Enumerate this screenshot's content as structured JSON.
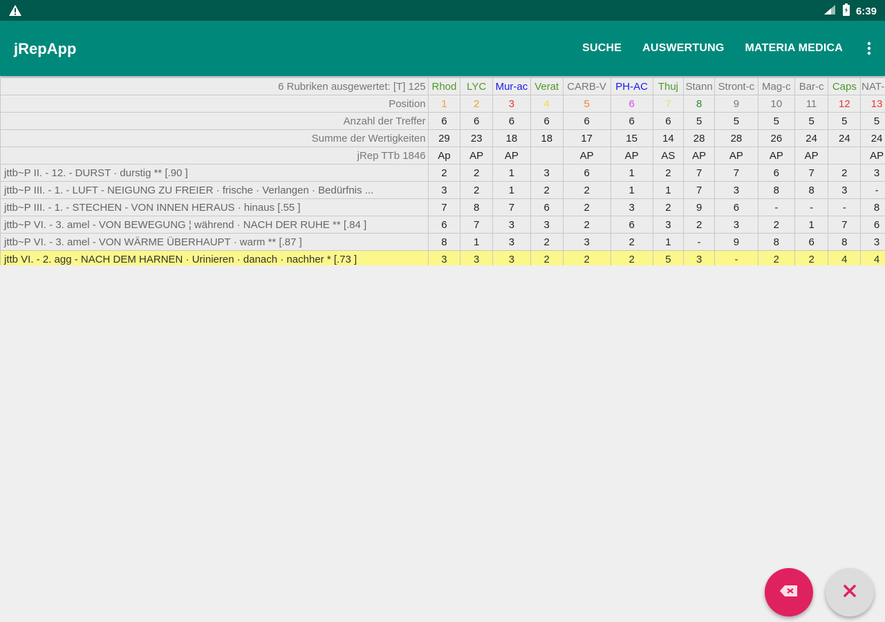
{
  "status": {
    "time": "6:39"
  },
  "appbar": {
    "title": "jRepApp",
    "actions": [
      "SUCHE",
      "AUSWERTUNG",
      "MATERIA MEDICA"
    ]
  },
  "table": {
    "header_label": "6 Rubriken ausgewertet:  [T] 125",
    "remedies": [
      {
        "name": "Rhod",
        "color": "#4c9a2a",
        "pos_color": "#f0a030"
      },
      {
        "name": "LYC",
        "color": "#4c9a2a",
        "pos_color": "#f0a030"
      },
      {
        "name": "Mur-ac",
        "color": "#1a1aee",
        "pos_color": "#e53935"
      },
      {
        "name": "Verat",
        "color": "#4c9a2a",
        "pos_color": "#f2e04a"
      },
      {
        "name": "CARB-V",
        "color": "#777777",
        "pos_color": "#ff7f27"
      },
      {
        "name": "PH-AC",
        "color": "#1a1aee",
        "pos_color": "#e040fb"
      },
      {
        "name": "Thuj",
        "color": "#4c9a2a",
        "pos_color": "#e8e070"
      },
      {
        "name": "Stann",
        "color": "#777777",
        "pos_color": "#2e8b2e"
      },
      {
        "name": "Stront-c",
        "color": "#777777",
        "pos_color": "#777777"
      },
      {
        "name": "Mag-c",
        "color": "#777777",
        "pos_color": "#777777"
      },
      {
        "name": "Bar-c",
        "color": "#777777",
        "pos_color": "#777777"
      },
      {
        "name": "Caps",
        "color": "#4c9a2a",
        "pos_color": "#e53935"
      },
      {
        "name": "NAT-C",
        "color": "#777777",
        "pos_color": "#e53935"
      }
    ],
    "position_label": "Position",
    "positions": [
      "1",
      "2",
      "3",
      "4",
      "5",
      "6",
      "7",
      "8",
      "9",
      "10",
      "11",
      "12",
      "13"
    ],
    "hits_label": "Anzahl der Treffer",
    "hits": [
      "6",
      "6",
      "6",
      "6",
      "6",
      "6",
      "6",
      "5",
      "5",
      "5",
      "5",
      "5",
      "5"
    ],
    "sum_label": "Summe der Wertigkeiten",
    "sums": [
      "29",
      "23",
      "18",
      "18",
      "17",
      "15",
      "14",
      "28",
      "28",
      "26",
      "24",
      "24",
      "24"
    ],
    "source_label": "jRep  TTb 1846",
    "sources": [
      "Ap",
      "AP",
      "AP",
      "",
      "AP",
      "AP",
      "AS",
      "AP",
      "AP",
      "AP",
      "AP",
      "",
      "AP"
    ],
    "rubrics": [
      {
        "text": "jttb~P  II. - 12. - DURST · durstig  **  [.90 ]",
        "values": [
          "2",
          "2",
          "1",
          "3",
          "6",
          "1",
          "2",
          "7",
          "7",
          "6",
          "7",
          "2",
          "3"
        ],
        "highlighted": false
      },
      {
        "text": "jttb~P  III. - 1. - LUFT - NEIGUNG ZU FREIER · frische · Verlangen · Bedürfnis  ...",
        "values": [
          "3",
          "2",
          "1",
          "2",
          "2",
          "1",
          "1",
          "7",
          "3",
          "8",
          "8",
          "3",
          "-"
        ],
        "highlighted": false
      },
      {
        "text": "jttb~P  III. - 1. - STECHEN - VON INNEN HERAUS · hinaus  [.55 ]",
        "values": [
          "7",
          "8",
          "7",
          "6",
          "2",
          "3",
          "2",
          "9",
          "6",
          "-",
          "-",
          "-",
          "8"
        ],
        "highlighted": false
      },
      {
        "text": "jttb~P  VI. - 3. amel - VON BEWEGUNG ¦ während · NACH DER RUHE  **  [.84 ]",
        "values": [
          "6",
          "7",
          "3",
          "3",
          "2",
          "6",
          "3",
          "2",
          "3",
          "2",
          "1",
          "7",
          "6"
        ],
        "highlighted": false
      },
      {
        "text": "jttb~P  VI. - 3. amel - VON WÄRME ÜBERHAUPT · warm  **  [.87 ]",
        "values": [
          "8",
          "1",
          "3",
          "2",
          "3",
          "2",
          "1",
          "-",
          "9",
          "8",
          "6",
          "8",
          "3"
        ],
        "highlighted": false
      },
      {
        "text": "jttb  VI. - 2. agg - NACH DEM HARNEN · Urinieren · danach · nachher  *  [.73 ]",
        "values": [
          "3",
          "3",
          "3",
          "2",
          "2",
          "2",
          "5",
          "3",
          "-",
          "2",
          "2",
          "4",
          "4"
        ],
        "highlighted": true
      }
    ]
  },
  "fabs": {
    "erase_icon": "backspace-icon",
    "close_icon": "close-icon",
    "close_color": "#e0215f"
  }
}
